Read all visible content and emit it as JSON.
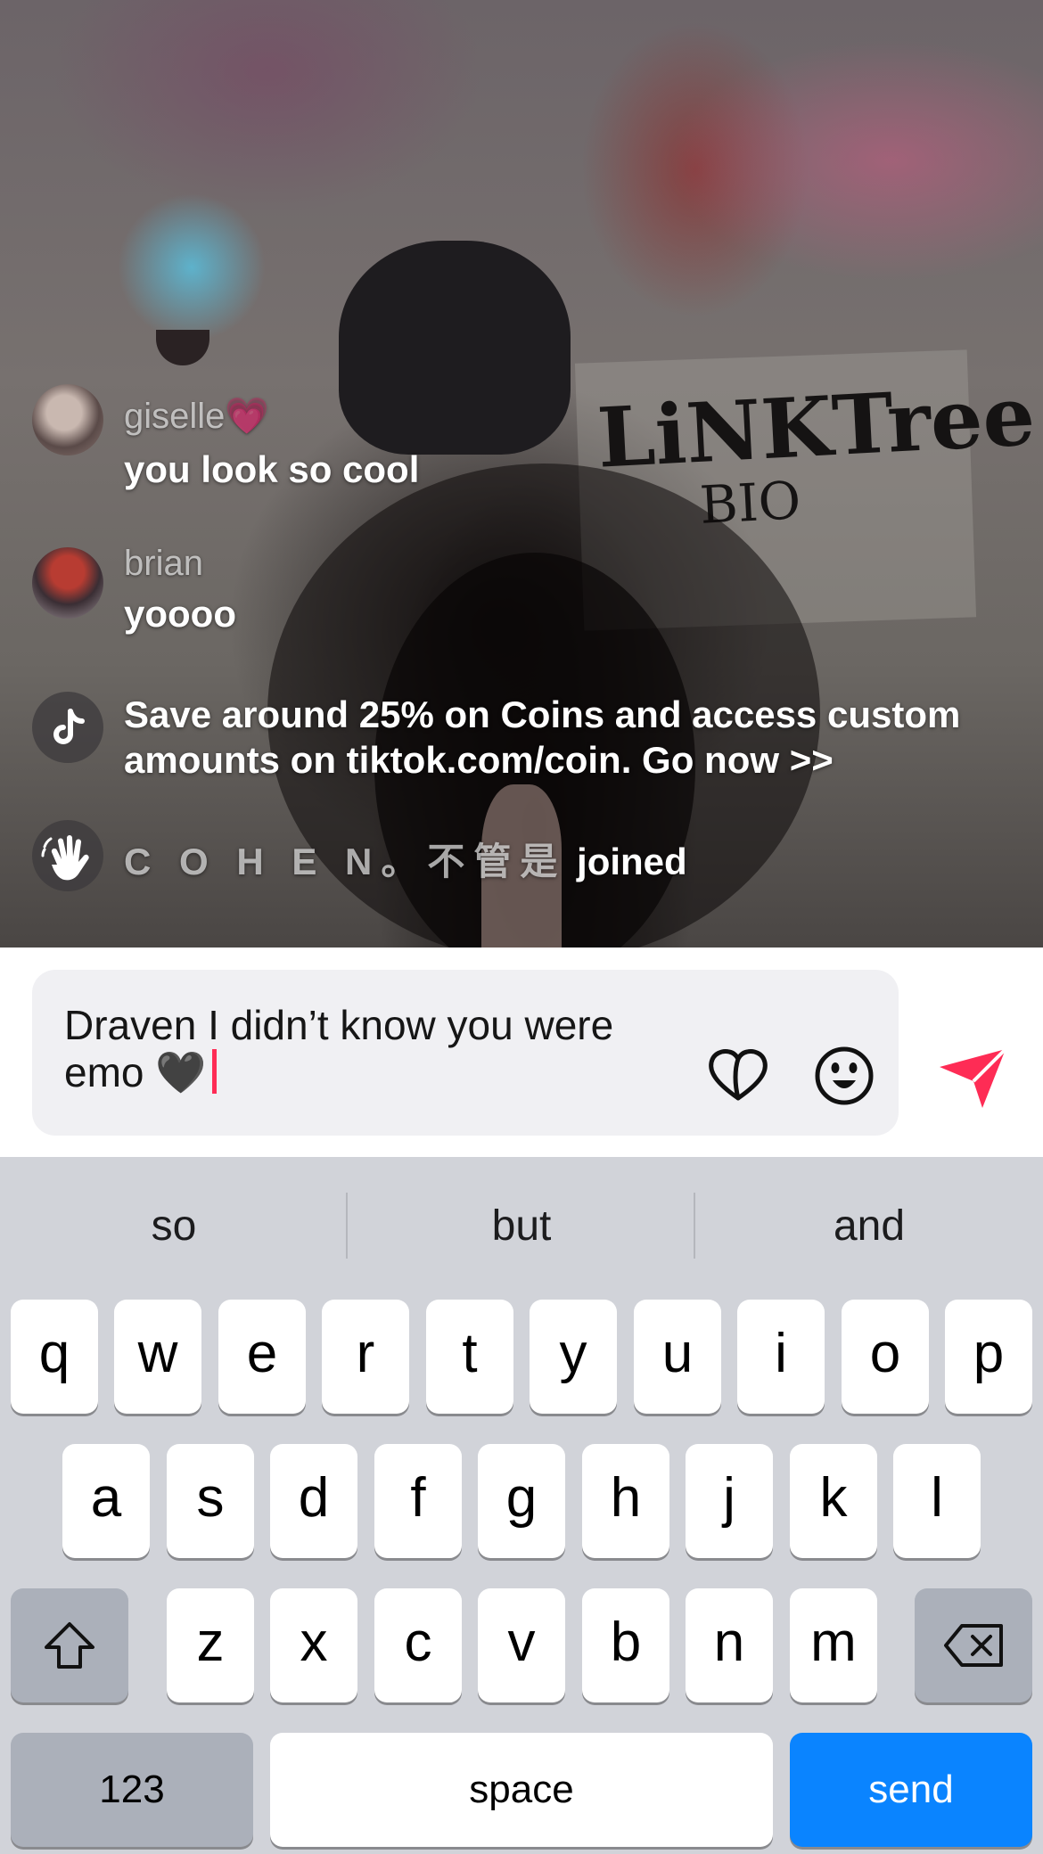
{
  "video": {
    "poster_title": "LiNKTree",
    "poster_subtitle": "BIO"
  },
  "comments": [
    {
      "username": "giselle💗",
      "message": "you look so cool"
    },
    {
      "username": "brian",
      "message": "yoooo"
    }
  ],
  "system_message": {
    "text": "Save around 25% on Coins and access custom amounts on tiktok.com/coin. Go now >>",
    "icon": "tiktok-logo-icon"
  },
  "join_event": {
    "user": "C O H E N。不管是",
    "suffix": "joined",
    "icon": "waving-hand-icon"
  },
  "input": {
    "text": "Draven I didn’t know you were emo 🖤",
    "heart_icon": "heart-outline-icon",
    "emoji_icon": "emoji-face-icon",
    "send_icon": "send-arrow-icon",
    "caret_color": "#fe2c55",
    "send_color": "#fe2c55"
  },
  "keyboard": {
    "suggestions": [
      "so",
      "but",
      "and"
    ],
    "row1": [
      "q",
      "w",
      "e",
      "r",
      "t",
      "y",
      "u",
      "i",
      "o",
      "p"
    ],
    "row2": [
      "a",
      "s",
      "d",
      "f",
      "g",
      "h",
      "j",
      "k",
      "l"
    ],
    "row3": [
      "z",
      "x",
      "c",
      "v",
      "b",
      "n",
      "m"
    ],
    "shift_icon": "shift-arrow-icon",
    "backspace_icon": "backspace-icon",
    "numbers_label": "123",
    "space_label": "space",
    "return_label": "send",
    "return_color": "#0a84ff"
  }
}
